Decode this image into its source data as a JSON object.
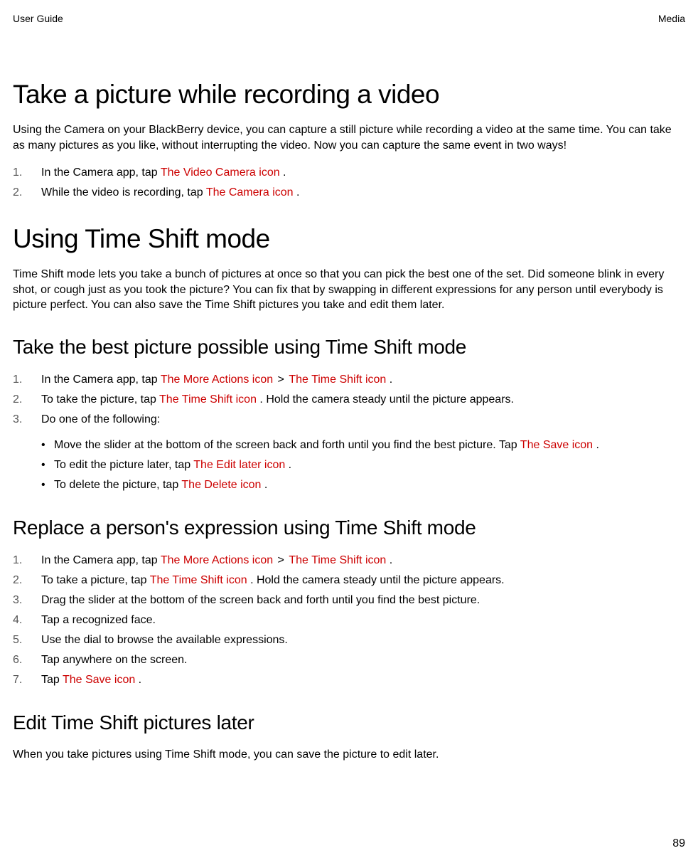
{
  "header": {
    "left": "User Guide",
    "right": "Media"
  },
  "section1": {
    "title": "Take a picture while recording a video",
    "intro": "Using the Camera on your BlackBerry device, you can capture a still picture while recording a video at the same time. You can take as many pictures as you like, without interrupting the video. Now you can capture the same event in two ways!",
    "step1_prefix": "In the Camera app, tap  ",
    "step1_icon": "The Video Camera icon",
    "step1_suffix": " .",
    "step2_prefix": "While the video is recording, tap  ",
    "step2_icon": "The Camera icon",
    "step2_suffix": " ."
  },
  "section2": {
    "title": "Using Time Shift mode",
    "intro": "Time Shift mode lets you take a bunch of pictures at once so that you can pick the best one of the set. Did someone blink in every shot, or cough just as you took the picture? You can fix that by swapping in different expressions for any person until everybody is picture perfect. You can also save the Time Shift pictures you take and edit them later."
  },
  "section3": {
    "title": "Take the best picture possible using Time Shift mode",
    "step1_prefix": "In the Camera app, tap  ",
    "step1_icon1": "The More Actions icon",
    "step1_sep": "  >  ",
    "step1_icon2": "The Time Shift icon",
    "step1_suffix": " .",
    "step2_prefix": "To take the picture, tap  ",
    "step2_icon": "The Time Shift icon",
    "step2_suffix": " . Hold the camera steady until the picture appears.",
    "step3": "Do one of the following:",
    "sub1_prefix": "Move the slider at the bottom of the screen back and forth until you find the best picture. Tap  ",
    "sub1_icon": "The Save icon",
    "sub1_suffix": " .",
    "sub2_prefix": "To edit the picture later, tap  ",
    "sub2_icon": "The Edit later icon",
    "sub2_suffix": " .",
    "sub3_prefix": "To delete the picture, tap  ",
    "sub3_icon": "The Delete icon",
    "sub3_suffix": " ."
  },
  "section4": {
    "title": "Replace a person's expression using Time Shift mode",
    "step1_prefix": "In the Camera app, tap  ",
    "step1_icon1": "The More Actions icon",
    "step1_sep": "  >  ",
    "step1_icon2": "The Time Shift icon",
    "step1_suffix": " .",
    "step2_prefix": "To take a picture, tap  ",
    "step2_icon": "The Time Shift icon",
    "step2_suffix": " . Hold the camera steady until the picture appears.",
    "step3": "Drag the slider at the bottom of the screen back and forth until you find the best picture.",
    "step4": "Tap a recognized face.",
    "step5": "Use the dial to browse the available expressions.",
    "step6": "Tap anywhere on the screen.",
    "step7_prefix": "Tap  ",
    "step7_icon": "The Save icon",
    "step7_suffix": " ."
  },
  "section5": {
    "title": "Edit Time Shift pictures later",
    "intro": "When you take pictures using Time Shift mode, you can save the picture to edit later."
  },
  "page_number": "89"
}
